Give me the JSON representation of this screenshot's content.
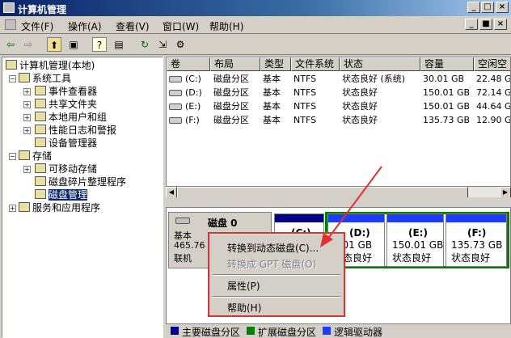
{
  "window": {
    "title": "计算机管理",
    "btn_min": "_",
    "btn_max": "□",
    "btn_close": "×"
  },
  "menubar": {
    "items": [
      "文件(F)",
      "操作(A)",
      "查看(V)",
      "窗口(W)",
      "帮助(H)"
    ],
    "child_min": "_",
    "child_max": "■",
    "child_close": "×"
  },
  "toolbar": {
    "back": "⇦",
    "forward": "⇨",
    "up": "⬆",
    "console_tree": "▣",
    "help": "?",
    "properties": "▤",
    "refresh": "↻",
    "export": "⇲",
    "settings": "⚙"
  },
  "tree": {
    "root": "计算机管理(本地)",
    "system_tools": "系统工具",
    "event_viewer": "事件查看器",
    "shared_folders": "共享文件夹",
    "local_users": "本地用户和组",
    "perf_logs": "性能日志和警报",
    "device_manager": "设备管理器",
    "storage": "存储",
    "removable": "可移动存储",
    "defrag": "磁盘碎片整理程序",
    "disk_mgmt": "磁盘管理",
    "services": "服务和应用程序"
  },
  "volumes": {
    "columns": [
      "卷",
      "布局",
      "类型",
      "文件系统",
      "状态",
      "容量",
      "空闲空"
    ],
    "rows": [
      [
        "(C:)",
        "磁盘分区",
        "基本",
        "NTFS",
        "状态良好 (系统)",
        "30.01 GB",
        "22.48 G"
      ],
      [
        "(D:)",
        "磁盘分区",
        "基本",
        "NTFS",
        "状态良好",
        "150.01 GB",
        "72.14 G"
      ],
      [
        "(E:)",
        "磁盘分区",
        "基本",
        "NTFS",
        "状态良好",
        "150.01 GB",
        "44.64 G"
      ],
      [
        "(F:)",
        "磁盘分区",
        "基本",
        "NTFS",
        "状态良好",
        "135.73 GB",
        "12.90 G"
      ]
    ]
  },
  "disk": {
    "name": "磁盘 0",
    "type": "基本",
    "size": "465.76 G",
    "status": "联机"
  },
  "partitions": [
    {
      "label": "(C:)",
      "size": "",
      "status": ""
    },
    {
      "label": "(D:)",
      "size": "0.01 GB",
      "status": "状态良好"
    },
    {
      "label": "(E:)",
      "size": "150.01 GB",
      "status": "状态良好"
    },
    {
      "label": "(F:)",
      "size": "135.73 GB",
      "status": "状态良好"
    }
  ],
  "context_menu": {
    "convert_dynamic": "转换到动态磁盘(C)...",
    "convert_gpt": "转换成 GPT 磁盘(O)",
    "properties": "属性(P)",
    "help": "帮助(H)"
  },
  "legend": [
    {
      "label": "主要磁盘分区",
      "color": "#00008b"
    },
    {
      "label": "扩展磁盘分区",
      "color": "#008000"
    },
    {
      "label": "逻辑驱动器",
      "color": "#1e3cff"
    }
  ],
  "colors": {
    "annotation": "#e03030",
    "extended": "#008000"
  }
}
